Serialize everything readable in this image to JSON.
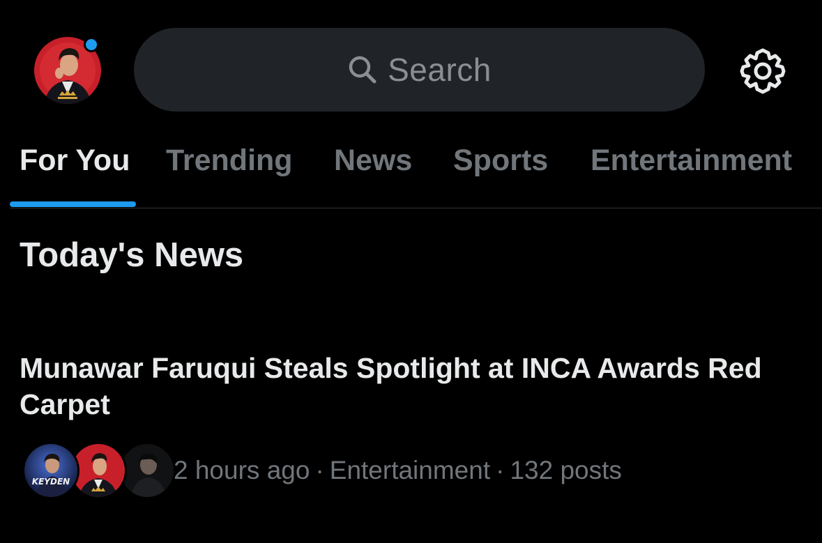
{
  "header": {
    "avatar": {
      "badge_color": "#1d9bf0"
    },
    "search": {
      "placeholder": "Search",
      "icon": "search-icon"
    },
    "settings": {
      "icon": "gear-icon"
    }
  },
  "tabs": [
    {
      "label": "For You",
      "active": true
    },
    {
      "label": "Trending",
      "active": false
    },
    {
      "label": "News",
      "active": false
    },
    {
      "label": "Sports",
      "active": false
    },
    {
      "label": "Entertainment",
      "active": false
    }
  ],
  "section": {
    "title": "Today's News"
  },
  "news": [
    {
      "headline": "Munawar Faruqui Steals Spotlight at INCA Awards Red Carpet",
      "time": "2 hours ago",
      "category": "Entertainment",
      "posts": "132 posts",
      "separator": "·",
      "avatars": [
        {
          "label": "KEYDEN"
        },
        {
          "label": ""
        },
        {
          "label": ""
        }
      ]
    }
  ],
  "colors": {
    "background": "#000000",
    "accent": "#1d9bf0",
    "text_primary": "#e7e9ea",
    "text_secondary": "#71767b",
    "search_bg": "#202327"
  }
}
